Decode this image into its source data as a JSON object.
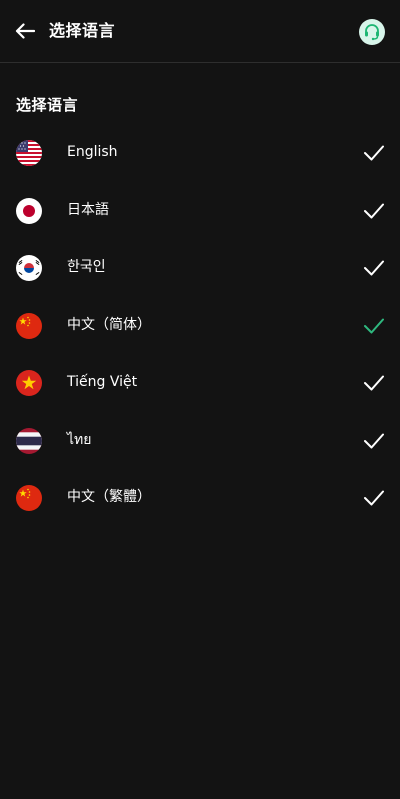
{
  "header": {
    "back_icon": "arrow-left-icon",
    "title": "选择语言",
    "support_icon": "headset-icon"
  },
  "section_title": "选择语言",
  "colors": {
    "background": "#131313",
    "text": "#ffffff",
    "selected_check": "#2fb87f",
    "unselected_check": "#ffffff",
    "support_bg": "#d8f5ea",
    "support_fg": "#1db673"
  },
  "languages": [
    {
      "label": "English",
      "flag": "us-flag-icon",
      "selected": false
    },
    {
      "label": "日本語",
      "flag": "japan-flag-icon",
      "selected": false
    },
    {
      "label": "한국인",
      "flag": "korea-flag-icon",
      "selected": false
    },
    {
      "label": "中文（简体）",
      "flag": "china-flag-icon",
      "selected": true
    },
    {
      "label": "Tiếng Việt",
      "flag": "vietnam-flag-icon",
      "selected": false
    },
    {
      "label": "ไทย",
      "flag": "thailand-flag-icon",
      "selected": false
    },
    {
      "label": "中文（繁體）",
      "flag": "china-flag-icon",
      "selected": false
    }
  ]
}
